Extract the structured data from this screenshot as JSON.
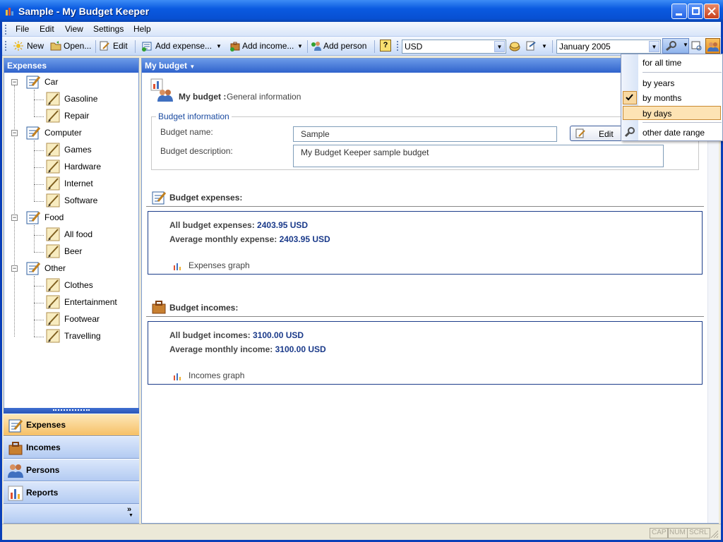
{
  "window": {
    "title": "Sample - My Budget Keeper"
  },
  "menu": [
    "File",
    "Edit",
    "View",
    "Settings",
    "Help"
  ],
  "toolbar": {
    "new": "New",
    "open": "Open...",
    "edit": "Edit",
    "add_expense": "Add expense...",
    "add_income": "Add income...",
    "add_person": "Add person",
    "help": "?",
    "currency": "USD",
    "period": "January 2005"
  },
  "left": {
    "header": "Expenses",
    "categories": [
      {
        "name": "Car",
        "children": [
          "Gasoline",
          "Repair"
        ]
      },
      {
        "name": "Computer",
        "children": [
          "Games",
          "Hardware",
          "Internet",
          "Software"
        ]
      },
      {
        "name": "Food",
        "children": [
          "All food",
          "Beer"
        ]
      },
      {
        "name": "Other",
        "children": [
          "Clothes",
          "Entertainment",
          "Footwear",
          "Travelling"
        ]
      }
    ],
    "nav": [
      "Expenses",
      "Incomes",
      "Persons",
      "Reports"
    ]
  },
  "main": {
    "header": "My budget",
    "title_bold": "My budget :",
    "title_rest": "General information",
    "group_label": "Budget information",
    "name_label": "Budget name:",
    "name_value": "Sample",
    "desc_label": "Budget description:",
    "desc_value": "My Budget Keeper sample budget",
    "edit_button": "Edit",
    "expenses_header": "Budget expenses:",
    "expenses_all_label": "All budget expenses:",
    "expenses_all_value": "2403.95  USD",
    "expenses_avg_label": "Average monthly expense:",
    "expenses_avg_value": "2403.95 USD",
    "expenses_graph": "Expenses graph",
    "incomes_header": "Budget incomes:",
    "incomes_all_label": "All budget incomes:",
    "incomes_all_value": "3100.00  USD",
    "incomes_avg_label": "Average monthly income:",
    "incomes_avg_value": "3100.00 USD",
    "incomes_graph": "Incomes graph"
  },
  "dropdown": {
    "items": [
      "for all time",
      "by years",
      "by months",
      "by days",
      "other date range"
    ],
    "checked": "by months",
    "hovered": "by days"
  },
  "status": [
    "CAP",
    "NUM",
    "SCRL"
  ]
}
